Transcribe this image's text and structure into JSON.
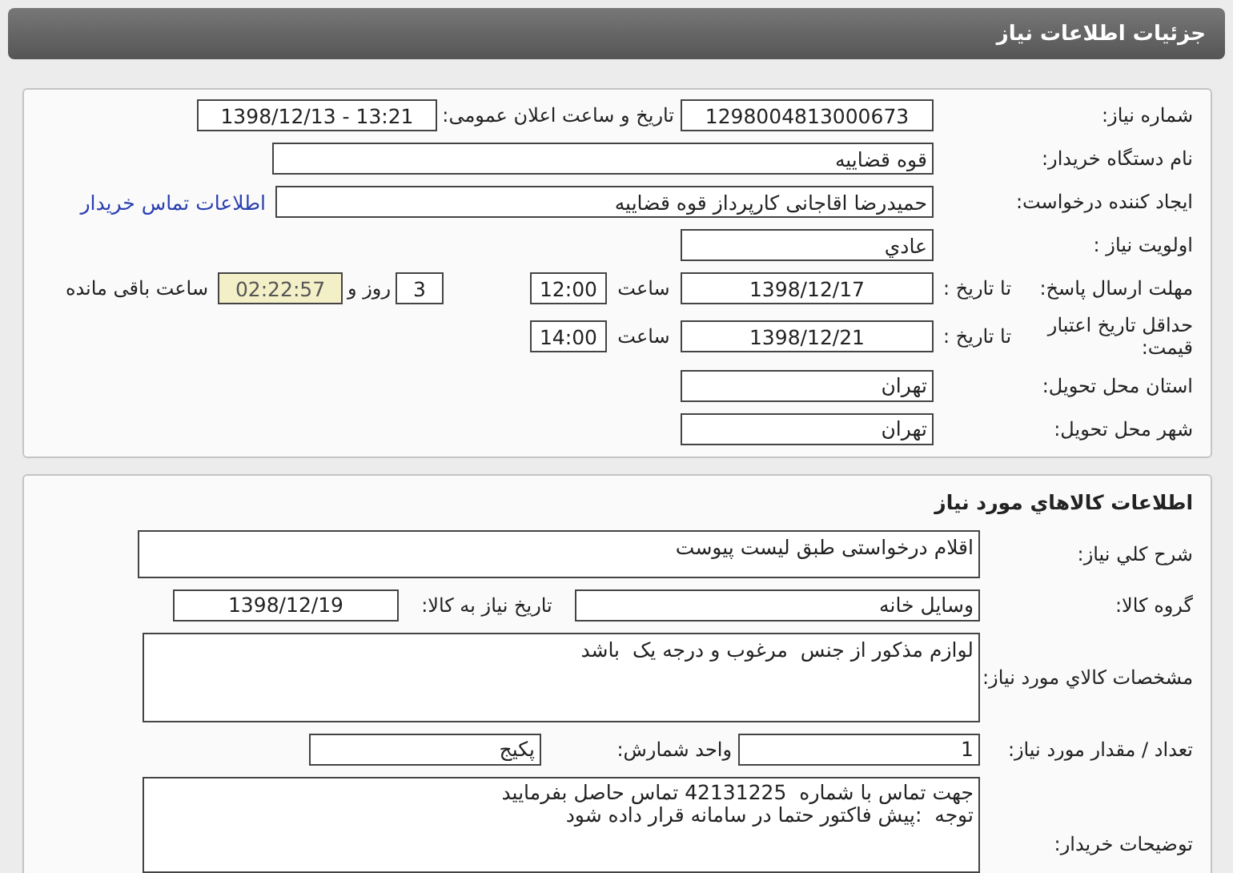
{
  "page_title": "جزئیات اطلاعات نیاز",
  "need": {
    "number_label": "شماره نیاز:",
    "number": "1298004813000673",
    "announce_label": "تاریخ و ساعت اعلان عمومی:",
    "announce": "1398/12/13 - 13:21",
    "buyer_org_label": "نام دستگاه خریدار:",
    "buyer_org": "قوه قضاییه",
    "creator_label": "ایجاد کننده درخواست:",
    "creator": "حمیدرضا اقاجانی کارپرداز قوه قضاییه",
    "contact_link": "اطلاعات تماس خریدار",
    "priority_label": "اولویت نیاز :",
    "priority": "عادي",
    "deadline_label": "مهلت ارسال پاسخ:",
    "deadline_to_label": "تا تاریخ :",
    "deadline_date": "1398/12/17",
    "deadline_time_label": "ساعت",
    "deadline_time": "12:00",
    "days": "3",
    "days_label": "روز و",
    "remaining": "02:22:57",
    "remaining_label": "ساعت باقی مانده",
    "validity_label": "حداقل تاریخ اعتبار قیمت:",
    "validity_to_label": "تا تاریخ :",
    "validity_date": "1398/12/21",
    "validity_time_label": "ساعت",
    "validity_time": "14:00",
    "province_label": "استان محل تحویل:",
    "province": "تهران",
    "city_label": "شهر محل تحویل:",
    "city": "تهران"
  },
  "goods": {
    "title": "اطلاعات کالاهاي مورد نياز",
    "summary_label": "شرح کلي نياز:",
    "summary": "اقلام درخواستی طبق لیست پیوست",
    "group_label": "گروه کالا:",
    "group": "وسایل خانه",
    "need_date_label": "تاریخ نیاز به کالا:",
    "need_date": "1398/12/19",
    "spec_label": "مشخصات کالاي مورد نياز:",
    "spec": "لوازم مذکور از جنس  مرغوب و درجه یک  باشد",
    "qty_label": "تعداد / مقدار مورد نیاز:",
    "qty": "1",
    "unit_label": "واحد شمارش:",
    "unit": "پکیج",
    "desc_label": "توضیحات خریدار:",
    "desc_lines": [
      "جهت تماس با شماره  42131225 تماس حاصل بفرمایید",
      "توجه  :پیش فاکتور حتما در سامانه قرار داده شود"
    ]
  }
}
